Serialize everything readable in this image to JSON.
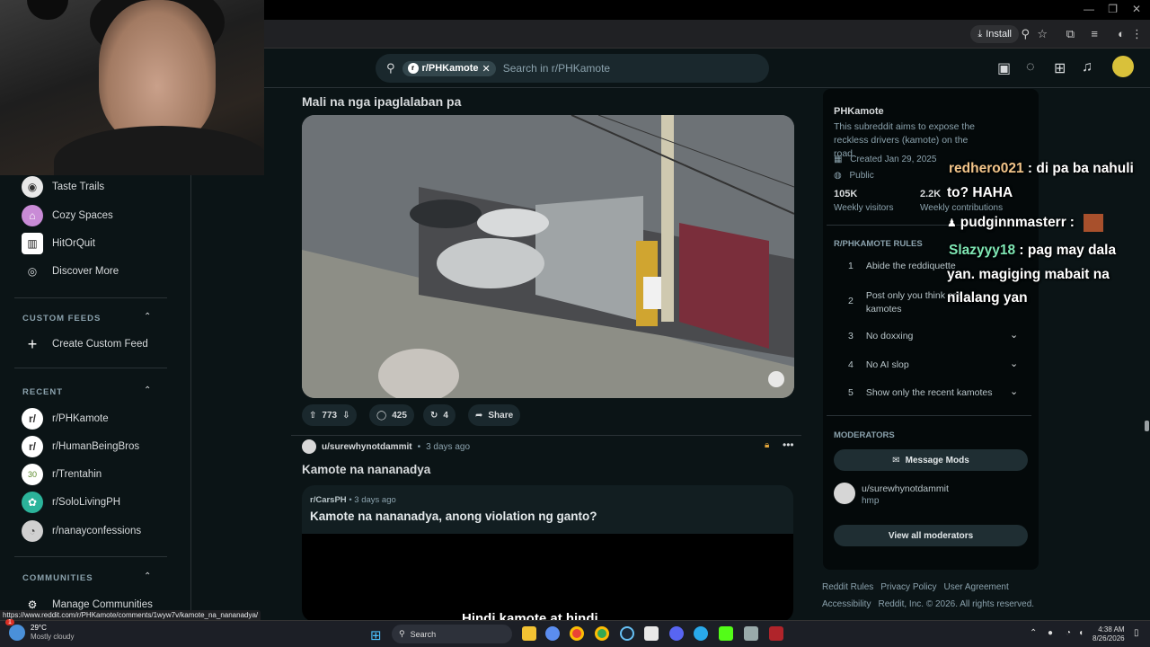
{
  "browser": {
    "install_label": "Install",
    "status_url": "https://www.reddit.com/r/PHKamote/comments/1wyw7v/kamote_na_nananadya/"
  },
  "search": {
    "community_chip": "r/PHKamote",
    "placeholder": "Search in r/PHKamote"
  },
  "sidebar": {
    "top_items": [
      {
        "label": "Taste Trails",
        "color": "#e8e8e8"
      },
      {
        "label": "Cozy Spaces",
        "color": "#c98bd6"
      },
      {
        "label": "HitOrQuit",
        "color": "#ffffff"
      },
      {
        "label": "Discover More",
        "color": "#0b1416"
      }
    ],
    "custom_feeds_heading": "CUSTOM FEEDS",
    "create_custom_feed": "Create Custom Feed",
    "recent_heading": "RECENT",
    "recent_items": [
      {
        "label": "r/PHKamote",
        "color": "#ffffff"
      },
      {
        "label": "r/HumanBeingBros",
        "color": "#ffffff"
      },
      {
        "label": "r/Trentahin",
        "color": "#ffffff"
      },
      {
        "label": "r/SoloLivingPH",
        "color": "#2bb39a"
      },
      {
        "label": "r/nanayconfessions",
        "color": "#d0d0d0"
      }
    ],
    "communities_heading": "COMMUNITIES",
    "manage_communities": "Manage Communities"
  },
  "post1": {
    "title": "Mali na nga ipaglalaban pa",
    "upvotes": "773",
    "comments": "425",
    "crossposts": "4",
    "share_label": "Share"
  },
  "post2": {
    "author": "u/surewhynotdammit",
    "time": "3 days ago",
    "title": "Kamote na nananadya",
    "crosspost_sub": "r/CarsPH",
    "crosspost_time": "3 days ago",
    "crosspost_title": "Kamote na nananadya, anong violation ng ganto?",
    "video_caption": "Hindi kamote at hindi"
  },
  "community": {
    "name": "PHKamote",
    "description": "This subreddit aims to expose the reckless drivers (kamote) on the road.",
    "created": "Created Jan 29, 2025",
    "visibility": "Public",
    "visitors_value": "105K",
    "visitors_label": "Weekly visitors",
    "contrib_value": "2.2K",
    "contrib_label": "Weekly contributions",
    "rules_heading": "R/PHKAMOTE RULES",
    "rules": [
      {
        "num": "1",
        "text": "Abide the reddiquette"
      },
      {
        "num": "2",
        "text": "Post only you think are kamotes"
      },
      {
        "num": "3",
        "text": "No doxxing"
      },
      {
        "num": "4",
        "text": "No AI slop"
      },
      {
        "num": "5",
        "text": "Show only the recent kamotes"
      }
    ],
    "moderators_heading": "MODERATORS",
    "message_mods": "Message Mods",
    "mod_name": "u/surewhynotdammit",
    "mod_flair": "hmp",
    "view_all_mods": "View all moderators",
    "footer_links": [
      "Reddit Rules",
      "Privacy Policy",
      "User Agreement",
      "Accessibility"
    ],
    "copyright": "Reddit, Inc. © 2026. All rights reserved."
  },
  "chat": [
    {
      "user": "redhero021",
      "user_color": "#f2c58a",
      "text": " : di pa ba nahuli"
    },
    {
      "text": "to? HAHA"
    },
    {
      "user": "pudginnmasterr",
      "user_color": "#ffffff",
      "text": " :"
    },
    {
      "user": "Slazyyy18",
      "user_color": "#7fe8b5",
      "text": " : pag may dala"
    },
    {
      "text": "yan. magiging mabait na"
    },
    {
      "text": "nilalang yan"
    }
  ],
  "taskbar": {
    "weather_temp": "29°C",
    "weather_desc": "Mostly cloudy",
    "search_placeholder": "Search",
    "time": "4:38 AM",
    "date": "8/26/2026",
    "notification_count": "1"
  }
}
